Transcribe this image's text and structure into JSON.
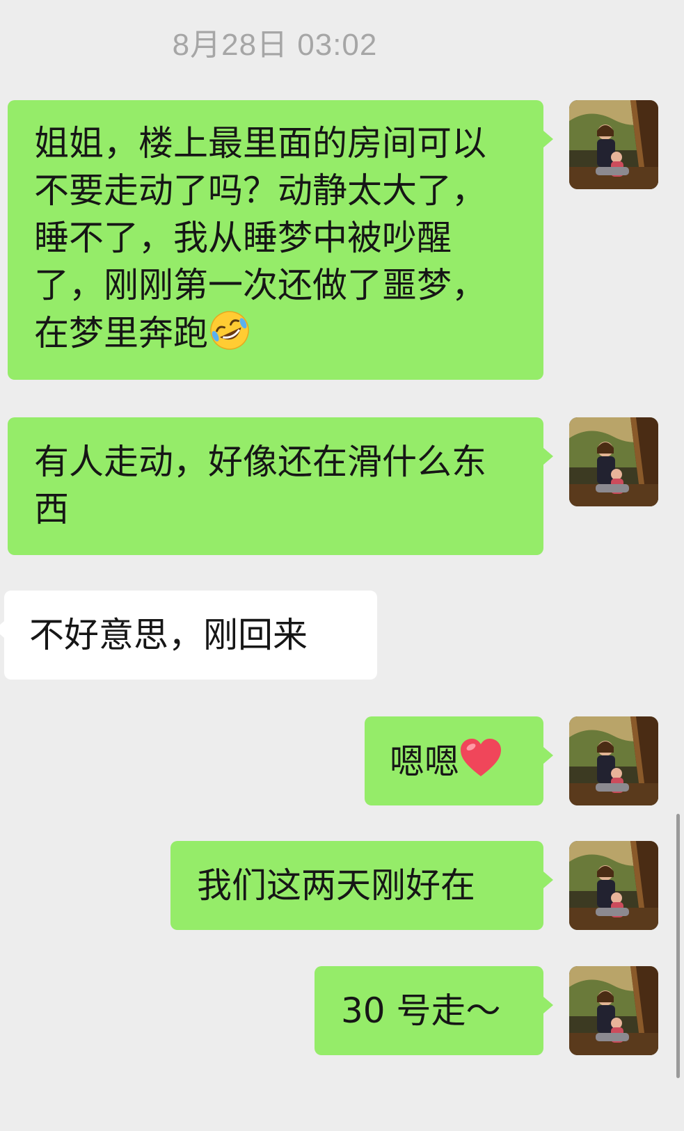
{
  "chat": {
    "timestamp": "8月28日 03:02",
    "messages": [
      {
        "side": "out",
        "text": "姐姐，楼上最里面的房间可以不要走动了吗？动静太大了，睡不了，我从睡梦中被吵醒了，刚刚第一次还做了噩梦，在梦里奔跑",
        "emoji": "rolling-on-floor-laughing-emoji"
      },
      {
        "side": "out",
        "text": "有人走动，好像还在滑什么东西"
      },
      {
        "side": "in",
        "text": "不好意思，刚回来"
      },
      {
        "side": "out",
        "text": "嗯嗯",
        "emoji": "red-heart-emoji"
      },
      {
        "side": "out",
        "text": "我们这两天刚好在"
      },
      {
        "side": "out",
        "text": "30 号走～"
      }
    ]
  },
  "colors": {
    "background": "#ededed",
    "outgoing_bubble": "#95ec69",
    "incoming_bubble": "#ffffff",
    "timestamp_text": "#a6a6a6"
  }
}
